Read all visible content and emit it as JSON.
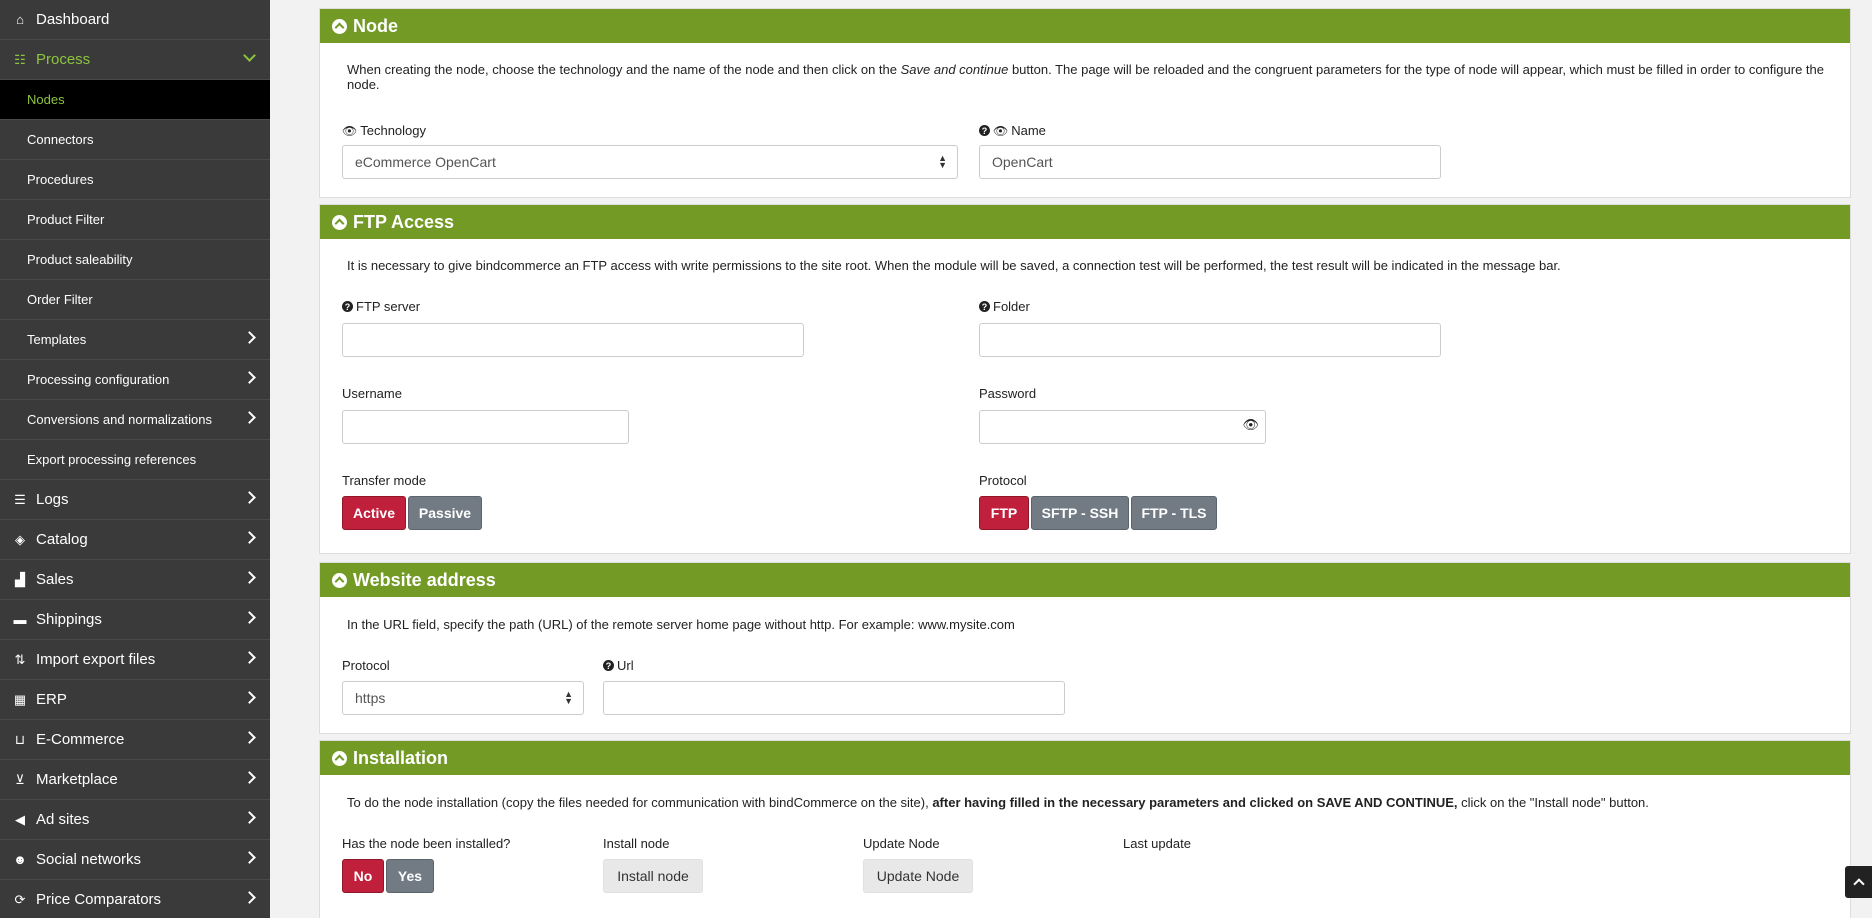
{
  "sidebar": {
    "items": [
      {
        "label": "Dashboard",
        "icon": "home-icon",
        "type": "top"
      },
      {
        "label": "Process",
        "icon": "process-icon",
        "type": "top-open"
      },
      {
        "label": "Nodes",
        "type": "sub-active"
      },
      {
        "label": "Connectors",
        "type": "sub"
      },
      {
        "label": "Procedures",
        "type": "sub"
      },
      {
        "label": "Product Filter",
        "type": "sub"
      },
      {
        "label": "Product saleability",
        "type": "sub"
      },
      {
        "label": "Order Filter",
        "type": "sub"
      },
      {
        "label": "Templates",
        "type": "sub-chev"
      },
      {
        "label": "Processing configuration",
        "type": "sub-chev"
      },
      {
        "label": "Conversions and normalizations",
        "type": "sub-chev"
      },
      {
        "label": "Export processing references",
        "type": "sub"
      },
      {
        "label": "Logs",
        "icon": "logs-icon",
        "type": "top-chev"
      },
      {
        "label": "Catalog",
        "icon": "box-icon",
        "type": "top-chev"
      },
      {
        "label": "Sales",
        "icon": "chart-icon",
        "type": "top-chev"
      },
      {
        "label": "Shippings",
        "icon": "truck-icon",
        "type": "top-chev"
      },
      {
        "label": "Import export files",
        "icon": "sort-icon",
        "type": "top-chev"
      },
      {
        "label": "ERP",
        "icon": "erp-icon",
        "type": "top-chev"
      },
      {
        "label": "E-Commerce",
        "icon": "basket-icon",
        "type": "top-chev"
      },
      {
        "label": "Marketplace",
        "icon": "cart-icon",
        "type": "top-chev"
      },
      {
        "label": "Ad sites",
        "icon": "megaphone-icon",
        "type": "top-chev"
      },
      {
        "label": "Social networks",
        "icon": "users-icon",
        "type": "top-chev"
      },
      {
        "label": "Price Comparators",
        "icon": "compare-icon",
        "type": "top-chev"
      }
    ]
  },
  "node": {
    "title": "Node",
    "desc_1": "When creating the node, choose the technology and the name of the node and then click on the ",
    "desc_em": "Save and continue",
    "desc_2": " button. The page will be reloaded and the congruent parameters for the type of node will appear, which must be filled in order to configure the node.",
    "technology_label": "Technology",
    "technology_value": "eCommerce OpenCart",
    "name_label": "Name",
    "name_value": "OpenCart"
  },
  "ftp": {
    "title": "FTP Access",
    "desc": "It is necessary to give bindcommerce an FTP access with write permissions to the site root. When the module will be saved, a connection test will be performed, the test result will be indicated in the message bar.",
    "server_label": "FTP server",
    "folder_label": "Folder",
    "username_label": "Username",
    "password_label": "Password",
    "transfer_label": "Transfer mode",
    "active_label": "Active",
    "passive_label": "Passive",
    "protocol_label": "Protocol",
    "ftp_label": "FTP",
    "sftp_label": "SFTP - SSH",
    "tls_label": "FTP - TLS"
  },
  "website": {
    "title": "Website address",
    "desc": "In the URL field, specify the path (URL) of the remote server home page without http. For example: www.mysite.com",
    "protocol_label": "Protocol",
    "protocol_value": "https",
    "url_label": "Url"
  },
  "install": {
    "title": "Installation",
    "desc_1": "To do the node installation (copy the files needed for communication with bindCommerce on the site), ",
    "desc_bold": "after having filled in the necessary parameters and clicked on SAVE AND CONTINUE,",
    "desc_2": " click on the \"Install node\" button.",
    "installed_label": "Has the node been installed?",
    "no_label": "No",
    "yes_label": "Yes",
    "install_node_label": "Install node",
    "install_node_button": "Install node",
    "update_node_label": "Update Node",
    "update_node_button": "Update Node",
    "last_update_label": "Last update"
  },
  "colors": {
    "accent_green": "#729a25",
    "active_red": "#c0203b",
    "sidebar_bg": "#3a3a3a",
    "highlight_green": "#8cc43e"
  }
}
